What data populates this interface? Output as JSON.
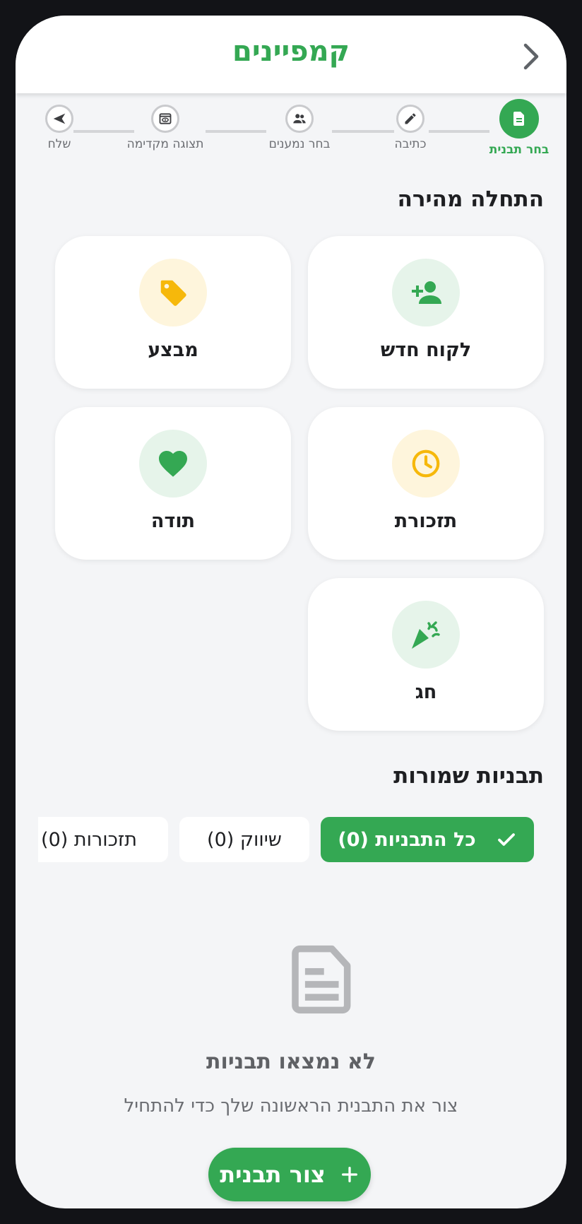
{
  "header": {
    "title": "קמפיינים",
    "back_icon": "chevron-right-icon"
  },
  "stepper": {
    "steps": [
      {
        "label": "בחר תבנית",
        "icon": "document-icon",
        "active": true
      },
      {
        "label": "כתיבה",
        "icon": "pencil-icon",
        "active": false
      },
      {
        "label": "בחר נמענים",
        "icon": "people-icon",
        "active": false
      },
      {
        "label": "תצוגה מקדימה",
        "icon": "preview-icon",
        "active": false
      },
      {
        "label": "שלח",
        "icon": "send-icon",
        "active": false
      }
    ]
  },
  "quick_start": {
    "title": "התחלה מהירה",
    "cards": [
      {
        "label": "לקוח חדש",
        "icon": "person-add-icon"
      },
      {
        "label": "מבצע",
        "icon": "tag-icon"
      },
      {
        "label": "תזכורת",
        "icon": "clock-icon"
      },
      {
        "label": "תודה",
        "icon": "heart-icon"
      },
      {
        "label": "חג",
        "icon": "party-popper-icon"
      }
    ]
  },
  "saved": {
    "title": "תבניות שמורות",
    "filters": [
      {
        "label": "כל התבניות (0)",
        "selected": true
      },
      {
        "label": "שיווק (0)",
        "selected": false
      },
      {
        "label": "תזכורות (0)",
        "selected": false
      }
    ]
  },
  "empty_state": {
    "icon": "document-icon",
    "title": "לא נמצאו תבניות",
    "subtitle": "צור את התבנית הראשונה שלך כדי להתחיל",
    "button_label": "צור תבנית"
  },
  "colors": {
    "accent": "#34a853",
    "warning": "#f6b80b",
    "background": "#f4f5f7"
  }
}
